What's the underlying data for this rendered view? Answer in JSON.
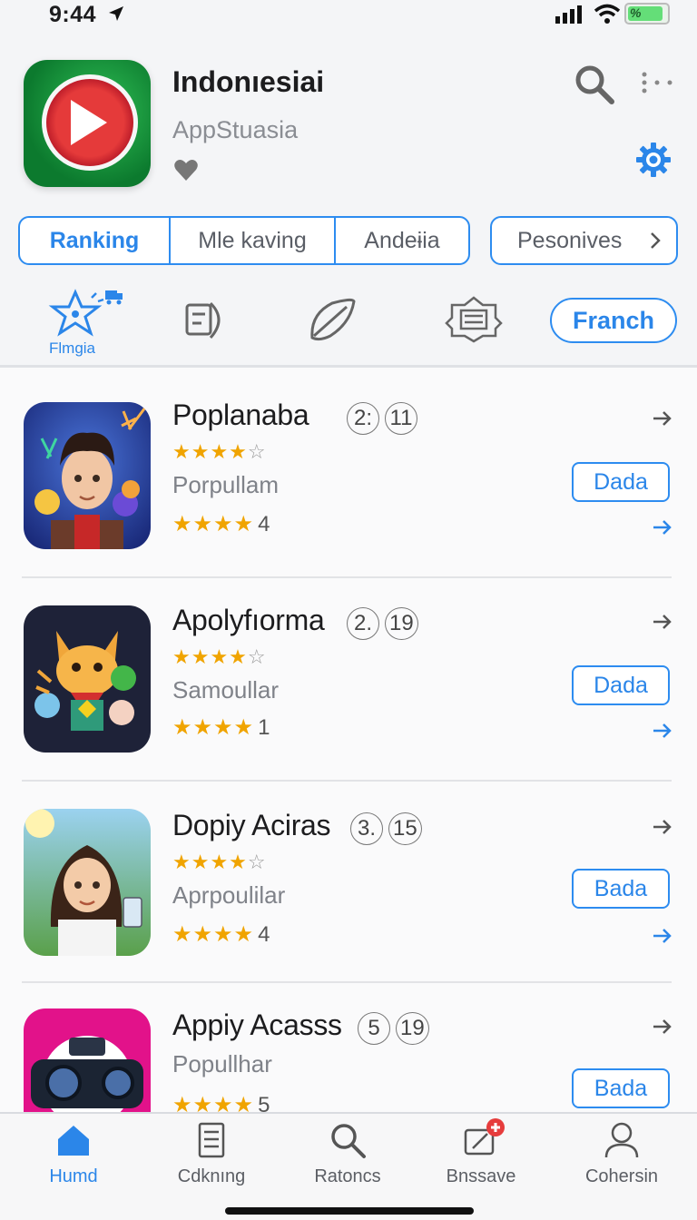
{
  "status_bar": {
    "time": "9:44",
    "battery_text": "%"
  },
  "header": {
    "app_name": "Indonıesiai",
    "subtitle": "AppStuasia"
  },
  "segments": [
    {
      "label": "Ranking",
      "active": true
    },
    {
      "label": "Mle kaving",
      "active": false
    },
    {
      "label": "Andeɨia",
      "active": false
    }
  ],
  "extra_segment": {
    "label": "Pesonives"
  },
  "categories": {
    "first_label": "Flmgia",
    "button_label": "Franch"
  },
  "apps": [
    {
      "title": "Poplanaba",
      "rank": [
        "2:",
        "11"
      ],
      "rating_top": "★★★★",
      "rating_top_empty": "☆",
      "subtitle": "Porpullam",
      "rating_bottom": "★★★★",
      "rating_count": "4",
      "button": "Dada"
    },
    {
      "title": "Apolyfıorma",
      "rank": [
        "2.",
        "19"
      ],
      "rating_top": "★★★★",
      "rating_top_empty": "☆",
      "subtitle": "Samoullar",
      "rating_bottom": "★★★★",
      "rating_count": "1",
      "button": "Dada"
    },
    {
      "title": "Dopiy Aciras",
      "rank": [
        "3.",
        "15"
      ],
      "rating_top": "★★★★",
      "rating_top_empty": "☆",
      "subtitle": "Aprpoulilar",
      "rating_bottom": "★★★★",
      "rating_count": "4",
      "button": "Bada"
    },
    {
      "title": "Appiy Acasss",
      "rank": [
        "5",
        "19"
      ],
      "rating_top": "",
      "rating_top_empty": "",
      "subtitle": "Popullhar",
      "rating_bottom": "★★★★",
      "rating_count": "5",
      "button": "Bada"
    }
  ],
  "tabs": [
    {
      "label": "Humd",
      "icon": "home-icon",
      "active": true
    },
    {
      "label": "Cdknıng",
      "icon": "document-icon",
      "active": false
    },
    {
      "label": "Ratoncs",
      "icon": "search-icon",
      "active": false
    },
    {
      "label": "Bnssave",
      "icon": "edit-badge-icon",
      "active": false
    },
    {
      "label": "Cohersin",
      "icon": "person-icon",
      "active": false
    }
  ],
  "colors": {
    "accent": "#2b86e9",
    "star": "#f0a400",
    "app_icon_green": "#0c7a2e",
    "app_icon_red": "#e53a3a"
  }
}
